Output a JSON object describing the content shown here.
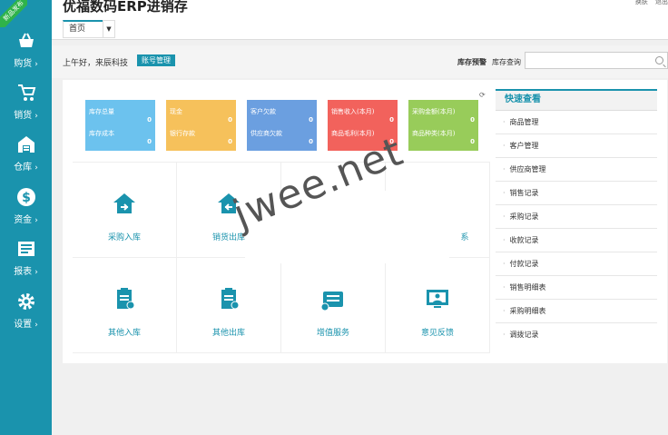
{
  "app": {
    "title": "优福数码ERP进销存",
    "top_links": [
      "换肤",
      "退出"
    ]
  },
  "corner_ribbon": "新品发布",
  "tabs": {
    "active": "首页"
  },
  "greeting": {
    "text": "上午好，来辰科技",
    "account_button": "账号管理"
  },
  "inventory": {
    "warning": "库存预警",
    "query": "库存查询",
    "search_placeholder": ""
  },
  "sidebar": {
    "items": [
      {
        "label": "购货",
        "icon": "basket-icon"
      },
      {
        "label": "销货",
        "icon": "cart-icon"
      },
      {
        "label": "仓库",
        "icon": "warehouse-icon"
      },
      {
        "label": "资金",
        "icon": "dollar-icon"
      },
      {
        "label": "报表",
        "icon": "report-icon"
      },
      {
        "label": "设置",
        "icon": "gear-icon"
      }
    ]
  },
  "stats": [
    {
      "color": "#6cc2ee",
      "rows": [
        {
          "label": "库存总量",
          "value": "0"
        },
        {
          "label": "库存成本",
          "value": "0"
        }
      ]
    },
    {
      "color": "#f6c15b",
      "rows": [
        {
          "label": "现金",
          "value": "0"
        },
        {
          "label": "银行存款",
          "value": "0"
        }
      ]
    },
    {
      "color": "#6b9fe0",
      "rows": [
        {
          "label": "客户欠款",
          "value": "0"
        },
        {
          "label": "供应商欠款",
          "value": "0"
        }
      ]
    },
    {
      "color": "#f2625c",
      "rows": [
        {
          "label": "销售收入(本月)",
          "value": "0"
        },
        {
          "label": "商品毛利(本月)",
          "value": "0"
        }
      ]
    },
    {
      "color": "#98cc5a",
      "rows": [
        {
          "label": "采购金额(本月)",
          "value": "0"
        },
        {
          "label": "商品种类(本月)",
          "value": "0"
        }
      ]
    }
  ],
  "actions": [
    {
      "label": "采购入库",
      "icon": "purchase-in-icon"
    },
    {
      "label": "销货出库",
      "icon": "sales-out-icon"
    },
    {
      "label": "",
      "icon": ""
    },
    {
      "label": "系",
      "icon": ""
    },
    {
      "label": "其他入库",
      "icon": "other-in-icon"
    },
    {
      "label": "其他出库",
      "icon": "other-out-icon"
    },
    {
      "label": "增值服务",
      "icon": "service-icon"
    },
    {
      "label": "意见反馈",
      "icon": "feedback-icon"
    }
  ],
  "quick_view": {
    "title": "快速查看",
    "items": [
      "商品管理",
      "客户管理",
      "供应商管理",
      "销售记录",
      "采购记录",
      "收款记录",
      "付款记录",
      "销售明细表",
      "采购明细表",
      "调拨记录"
    ]
  },
  "watermark": "jwee.net",
  "colors": {
    "sidebar": "#1a93ad",
    "accent": "#1a93ad",
    "ribbon": "#2fb34a"
  }
}
